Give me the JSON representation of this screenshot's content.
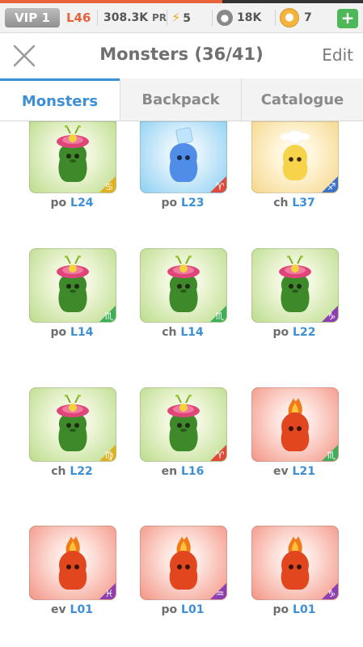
{
  "status_bar": {
    "vip": "VIP 1",
    "level": "L46",
    "power_value": "308.3K",
    "power_unit": "PR",
    "energy": "5",
    "food": "18K",
    "coins": "7",
    "add_label": "+"
  },
  "header": {
    "title": "Monsters (36/41)",
    "edit_label": "Edit"
  },
  "tabs": [
    {
      "label": "Monsters",
      "active": true
    },
    {
      "label": "Backpack",
      "active": false
    },
    {
      "label": "Catalogue",
      "active": false
    }
  ],
  "monsters": [
    {
      "prefix": "po",
      "level": "L24",
      "type": "plant",
      "bg": "green",
      "badge_color": "#e0b01f",
      "zodiac": "♋"
    },
    {
      "prefix": "po",
      "level": "L23",
      "type": "ice",
      "bg": "blue",
      "badge_color": "#e04a3a",
      "zodiac": "♈"
    },
    {
      "prefix": "ch",
      "level": "L37",
      "type": "light",
      "bg": "yellow",
      "badge_color": "#3b73c8",
      "zodiac": "♐"
    },
    {
      "prefix": "po",
      "level": "L14",
      "type": "plant",
      "bg": "green",
      "badge_color": "#3fae5a",
      "zodiac": "♏"
    },
    {
      "prefix": "ch",
      "level": "L14",
      "type": "plant",
      "bg": "green",
      "badge_color": "#3fae5a",
      "zodiac": "♏"
    },
    {
      "prefix": "po",
      "level": "L22",
      "type": "plant",
      "bg": "green",
      "badge_color": "#8b3fb0",
      "zodiac": "♑"
    },
    {
      "prefix": "ch",
      "level": "L22",
      "type": "plant",
      "bg": "green",
      "badge_color": "#e0b01f",
      "zodiac": "♍"
    },
    {
      "prefix": "en",
      "level": "L16",
      "type": "plant",
      "bg": "green",
      "badge_color": "#e04a3a",
      "zodiac": "♈"
    },
    {
      "prefix": "ev",
      "level": "L21",
      "type": "fire",
      "bg": "red",
      "badge_color": "#3fae5a",
      "zodiac": "♏"
    },
    {
      "prefix": "ev",
      "level": "L01",
      "type": "fire",
      "bg": "red",
      "badge_color": "#8b3fb0",
      "zodiac": "♓"
    },
    {
      "prefix": "po",
      "level": "L01",
      "type": "fire",
      "bg": "red",
      "badge_color": "#8b3fb0",
      "zodiac": "♒"
    },
    {
      "prefix": "po",
      "level": "L01",
      "type": "fire",
      "bg": "red",
      "badge_color": "#8b3fb0",
      "zodiac": "♑"
    }
  ]
}
